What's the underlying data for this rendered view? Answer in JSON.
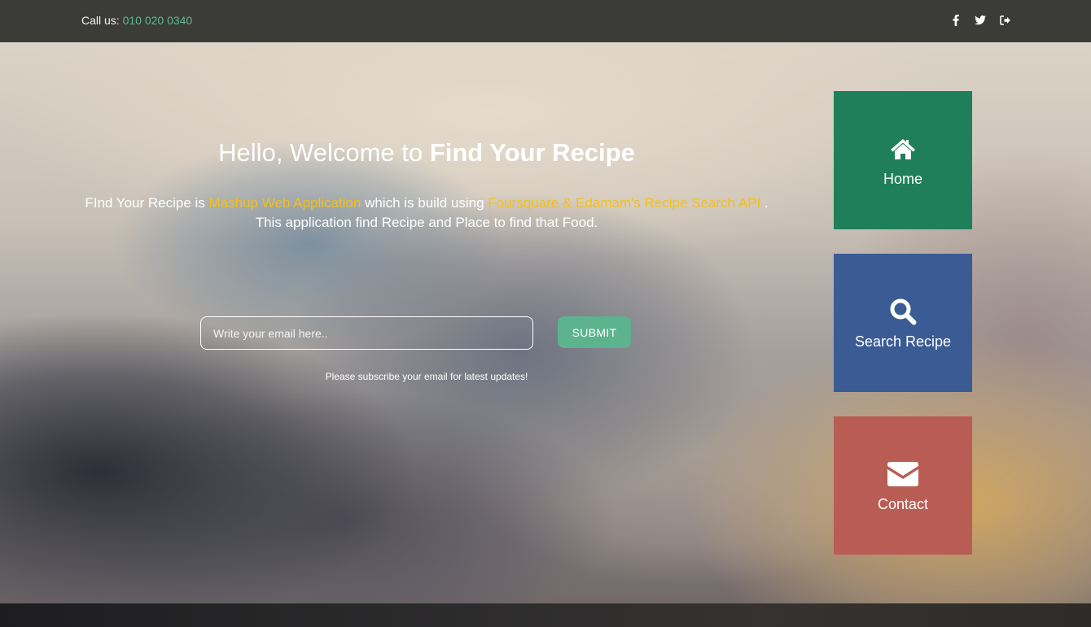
{
  "topbar": {
    "call_label": "Call us:",
    "phone": "010 020 0340",
    "social_icons": [
      "facebook-icon",
      "twitter-icon",
      "sign-out-icon"
    ]
  },
  "hero": {
    "title_prefix": "Hello, Welcome to ",
    "title_bold": "Find Your Recipe",
    "desc_part1": "FInd Your Recipe is ",
    "desc_highlight1": "Mashup Web Application",
    "desc_part2": " which is build using ",
    "desc_highlight2": "Foursquare & Edamam's Recipe Search API",
    "desc_part3": " . This application find Recipe and Place to find that Food."
  },
  "subscribe": {
    "email_value": "",
    "email_placeholder": "Write your email here..",
    "submit_label": "SUBMIT",
    "note": "Please subscribe your email for latest updates!"
  },
  "tiles": [
    {
      "label": "Home",
      "icon": "home-icon",
      "color": "#1f7f5b"
    },
    {
      "label": "Search Recipe",
      "icon": "search-icon",
      "color": "#3a5b94"
    },
    {
      "label": "Contact",
      "icon": "envelope-icon",
      "color": "#b95d54"
    }
  ],
  "colors": {
    "accent_green": "#5cb38d",
    "highlight_yellow": "#f2c01e",
    "phone_green": "#5fba93"
  }
}
